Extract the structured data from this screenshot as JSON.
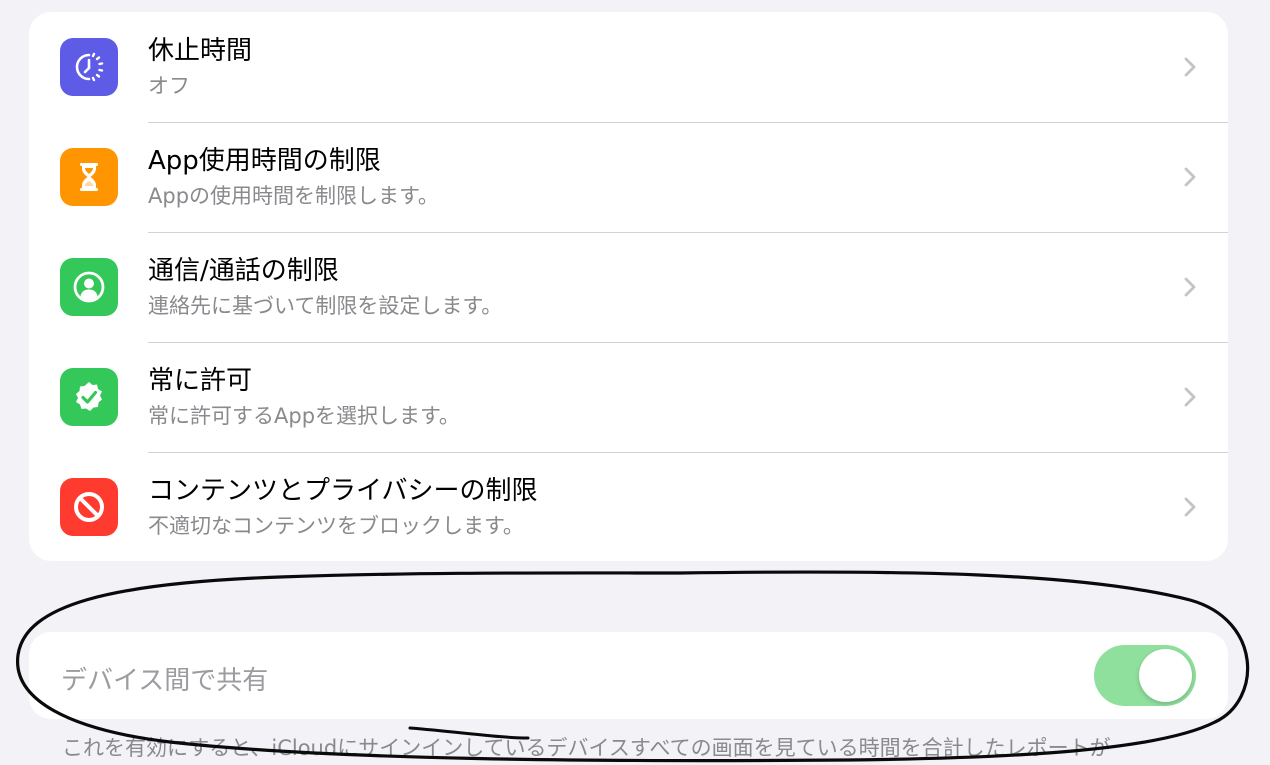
{
  "limits": {
    "items": [
      {
        "title": "休止時間",
        "subtitle": "オフ",
        "icon": "downtime-icon",
        "color": "#5e5ce6"
      },
      {
        "title": "App使用時間の制限",
        "subtitle": "Appの使用時間を制限します。",
        "icon": "hourglass-icon",
        "color": "#ff9500"
      },
      {
        "title": "通信/通話の制限",
        "subtitle": "連絡先に基づいて制限を設定します。",
        "icon": "person-circle-icon",
        "color": "#34c759"
      },
      {
        "title": "常に許可",
        "subtitle": "常に許可するAppを選択します。",
        "icon": "checkmark-seal-icon",
        "color": "#34c759"
      },
      {
        "title": "コンテンツとプライバシーの制限",
        "subtitle": "不適切なコンテンツをブロックします。",
        "icon": "prohibited-icon",
        "color": "#ff3b30"
      }
    ]
  },
  "share": {
    "label": "デバイス間で共有",
    "enabled": true,
    "toggle_color": "#8fdf9d"
  },
  "footer": {
    "text": "これを有効にすると、iCloudにサインインしているデバイスすべての画面を見ている時間を合計したレポートが"
  }
}
